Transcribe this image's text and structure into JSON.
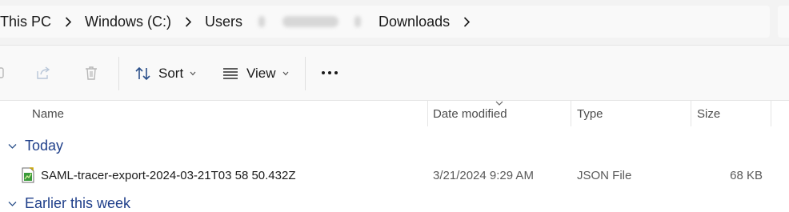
{
  "breadcrumb": {
    "this_pc": "This PC",
    "drive": "Windows (C:)",
    "users": "Users",
    "downloads": "Downloads"
  },
  "toolbar": {
    "sort_label": "Sort",
    "view_label": "View"
  },
  "columns": {
    "name": "Name",
    "date_modified": "Date modified",
    "type": "Type",
    "size": "Size"
  },
  "groups": {
    "today": "Today",
    "earlier": "Earlier this week"
  },
  "files": [
    {
      "name": "SAML-tracer-export-2024-03-21T03 58 50.432Z",
      "date_modified": "3/21/2024 9:29 AM",
      "type": "JSON File",
      "size": "68 KB"
    }
  ],
  "colors": {
    "group_label": "#1f3f8a",
    "accent": "#0067c0"
  },
  "icons": {
    "chevron": "chevron-right-icon",
    "share": "share-icon",
    "delete": "trash-icon",
    "sort": "sort-icon",
    "view": "view-icon",
    "more": "more-icon",
    "json_file": "json-file-icon"
  }
}
